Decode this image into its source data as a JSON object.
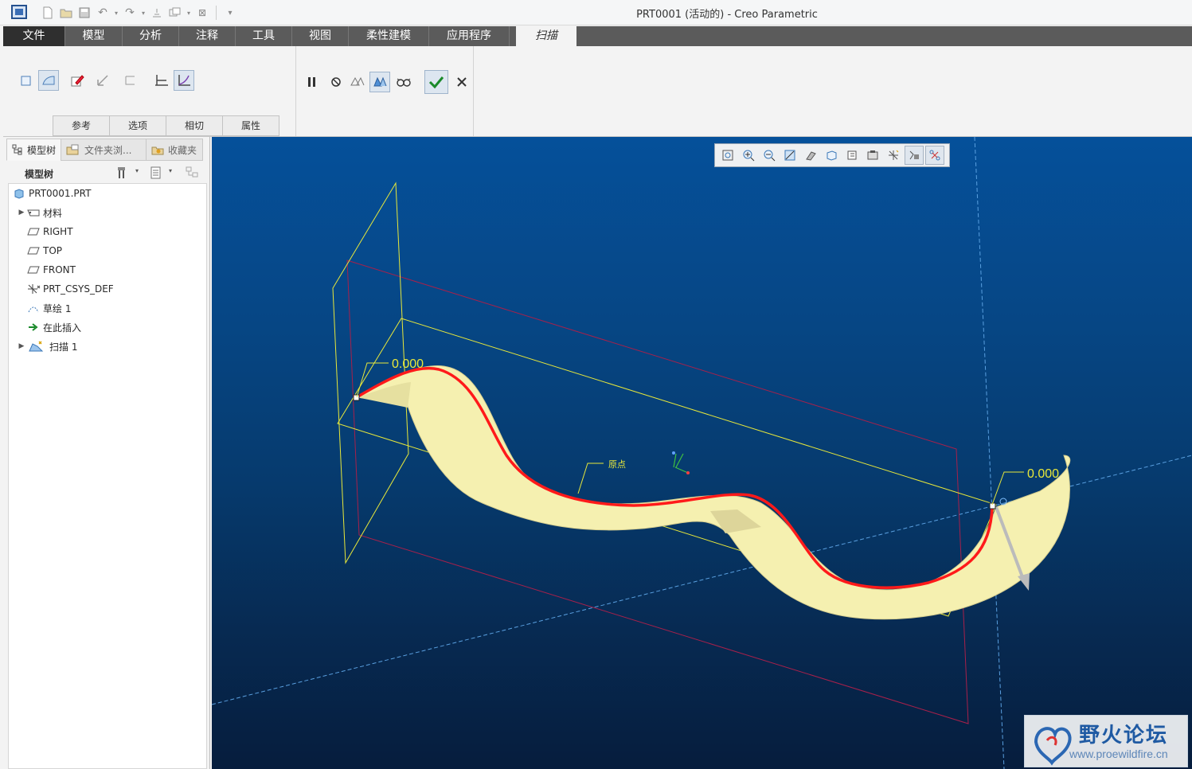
{
  "window": {
    "title": "PRT0001 (活动的) - Creo Parametric"
  },
  "ribbon_tabs": {
    "file": "文件",
    "items": [
      "模型",
      "分析",
      "注释",
      "工具",
      "视图",
      "柔性建模",
      "应用程序"
    ],
    "active": "扫描"
  },
  "sweep_dashboard": {
    "slide_tabs": [
      "参考",
      "选项",
      "相切",
      "属性"
    ]
  },
  "panel_tabs": {
    "model_tree": "模型树",
    "folder_browser": "文件夹浏...",
    "favorites": "收藏夹"
  },
  "model_tree": {
    "header": "模型树",
    "items": [
      {
        "label": "PRT0001.PRT",
        "icon": "part-icon"
      },
      {
        "label": "材料",
        "icon": "material-icon"
      },
      {
        "label": "RIGHT",
        "icon": "datum-plane-icon"
      },
      {
        "label": "TOP",
        "icon": "datum-plane-icon"
      },
      {
        "label": "FRONT",
        "icon": "datum-plane-icon"
      },
      {
        "label": "PRT_CSYS_DEF",
        "icon": "csys-icon"
      },
      {
        "label": "草绘 1",
        "icon": "sketch-icon"
      },
      {
        "label": "在此插入",
        "icon": "insert-arrow-icon"
      },
      {
        "label": "扫描 1",
        "icon": "sweep-icon"
      }
    ]
  },
  "viewport": {
    "dim_left": "0.000",
    "dim_right": "0.000",
    "origin_label": "原点"
  },
  "watermark": {
    "title": "野火论坛",
    "url": "www.proewildfire.cn"
  },
  "colors": {
    "accent": "#3a6db5",
    "trajectory": "#ff1a1a",
    "sketch": "#ffff33",
    "datum": "#a8204a",
    "surface": "#f5f0b0"
  }
}
